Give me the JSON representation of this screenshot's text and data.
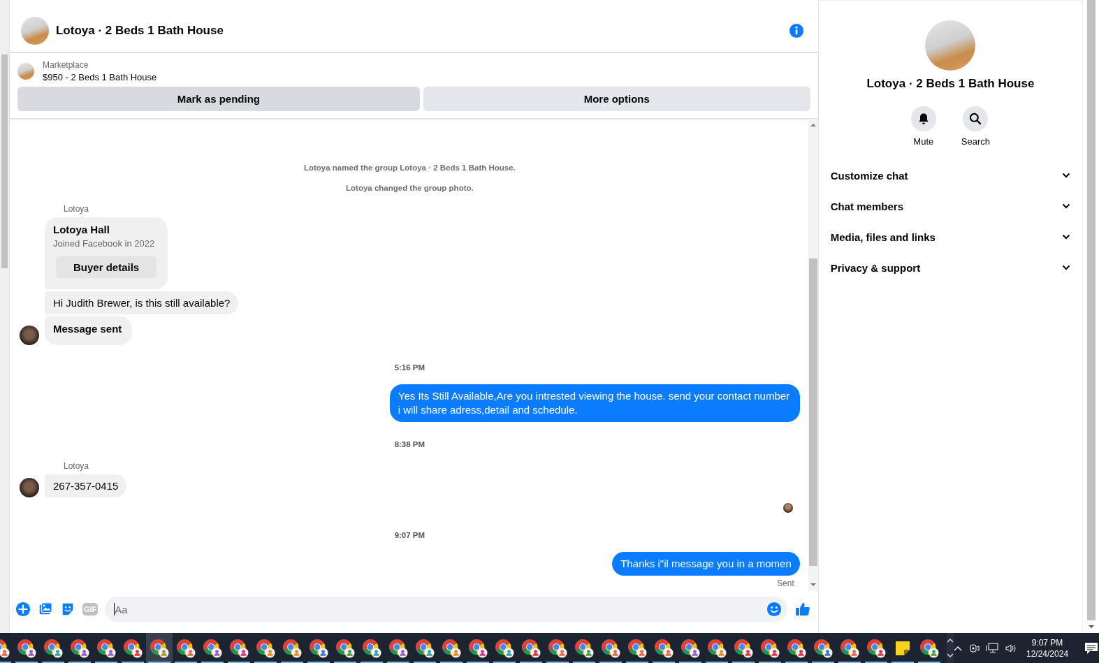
{
  "chat_header": {
    "title": "Lotoya · 2 Beds 1 Bath House"
  },
  "listing": {
    "label": "Marketplace",
    "title": "$950 - 2 Beds 1 Bath House",
    "buttons": [
      "Mark as pending",
      "More options"
    ]
  },
  "messages": [
    {
      "kind": "system",
      "text": "Lotoya named the group Lotoya · 2 Beds 1 Bath House."
    },
    {
      "kind": "system",
      "text": "Lotoya changed the group photo."
    },
    {
      "kind": "group",
      "sender": "Lotoya",
      "items": [
        {
          "kind": "buyer_card",
          "name": "Lotoya Hall",
          "subtitle": "Joined Facebook in 2022",
          "button": "Buyer details"
        },
        {
          "kind": "text",
          "text": "Hi Judith Brewer, is this still available?"
        },
        {
          "kind": "notice",
          "text": "Message sent"
        }
      ]
    },
    {
      "kind": "time",
      "text": "5:16 PM"
    },
    {
      "kind": "outgoing",
      "text": "Yes Its Still Available,Are you intrested viewing the house. send your contact number i will share adress,detail and schedule."
    },
    {
      "kind": "time",
      "text": "8:38 PM"
    },
    {
      "kind": "group",
      "sender": "Lotoya",
      "items": [
        {
          "kind": "text",
          "text": "267-357-0415"
        }
      ]
    },
    {
      "kind": "read_receipt"
    },
    {
      "kind": "time",
      "text": "9:07 PM"
    },
    {
      "kind": "outgoing",
      "text": "Thanks i\"il message you in a momen",
      "status": "Sent"
    }
  ],
  "composer": {
    "gif_label": "GIF",
    "placeholder": "Aa"
  },
  "details_panel": {
    "title": "Lotoya · 2 Beds 1 Bath House",
    "actions": [
      {
        "kind": "mute",
        "label": "Mute"
      },
      {
        "kind": "search",
        "label": "Search"
      }
    ],
    "sections": [
      {
        "label": "Customize chat",
        "expanded": false
      },
      {
        "label": "Chat members",
        "expanded": false
      },
      {
        "label": "Media, files and links",
        "expanded": false
      },
      {
        "label": "Privacy & support",
        "expanded": false
      }
    ]
  },
  "taskbar": {
    "apps": [
      {
        "kind": "browser",
        "color": "#e8664a",
        "selected": false
      },
      {
        "kind": "browser",
        "color": "#9b59c9",
        "selected": false
      },
      {
        "kind": "browser",
        "color": "#3b9fa3",
        "selected": false
      },
      {
        "kind": "browser",
        "color": "#9b59c9",
        "selected": false
      },
      {
        "kind": "browser",
        "color": "#9b59c9",
        "selected": false
      },
      {
        "kind": "browser",
        "color": "#e0334a",
        "selected": false
      },
      {
        "kind": "browser",
        "color": "#a09a3a",
        "selected": true
      },
      {
        "kind": "browser",
        "color": "#e8664a",
        "selected": false
      },
      {
        "kind": "browser",
        "color": "#9b59c9",
        "selected": false
      },
      {
        "kind": "browser",
        "color": "#d6338a",
        "selected": false
      },
      {
        "kind": "browser",
        "color": "#e88a2a",
        "selected": false
      },
      {
        "kind": "browser",
        "color": "#e88a2a",
        "selected": false
      },
      {
        "kind": "browser",
        "color": "#3a6fd6",
        "selected": false
      },
      {
        "kind": "browser",
        "color": "#4f9a4a",
        "selected": false
      },
      {
        "kind": "browser",
        "color": "#3b9fa3",
        "selected": false
      },
      {
        "kind": "browser",
        "color": "#9b59c9",
        "selected": false
      },
      {
        "kind": "browser",
        "color": "#3b9fa3",
        "selected": false
      },
      {
        "kind": "browser",
        "color": "#e88a2a",
        "selected": false
      },
      {
        "kind": "browser",
        "color": "#d6338a",
        "selected": false
      },
      {
        "kind": "browser",
        "color": "#3b9fa3",
        "selected": false
      },
      {
        "kind": "browser",
        "color": "#e0334a",
        "selected": false
      },
      {
        "kind": "browser",
        "color": "#e8664a",
        "selected": false
      },
      {
        "kind": "browser",
        "color": "#4f9a4a",
        "selected": false
      },
      {
        "kind": "browser",
        "color": "#e8664a",
        "selected": false
      },
      {
        "kind": "browser",
        "color": "#e8664a",
        "selected": false
      },
      {
        "kind": "browser",
        "color": "#e8664a",
        "selected": false
      },
      {
        "kind": "browser",
        "color": "#9b59c9",
        "selected": false
      },
      {
        "kind": "browser",
        "color": "#e88a2a",
        "selected": false
      },
      {
        "kind": "browser",
        "color": "#e0334a",
        "selected": false
      },
      {
        "kind": "browser",
        "color": "#e0334a",
        "selected": false
      },
      {
        "kind": "browser",
        "color": "#e0334a",
        "selected": false
      },
      {
        "kind": "browser",
        "color": "#3a6fd6",
        "selected": false
      },
      {
        "kind": "browser",
        "color": "#e8664a",
        "selected": false
      },
      {
        "kind": "browser",
        "color": "#e0334a",
        "selected": false
      },
      {
        "kind": "notes",
        "selected": false
      },
      {
        "kind": "browser",
        "color": "#4f9a4a",
        "selected": false
      }
    ],
    "time": "9:07 PM",
    "date": "12/24/2024"
  }
}
